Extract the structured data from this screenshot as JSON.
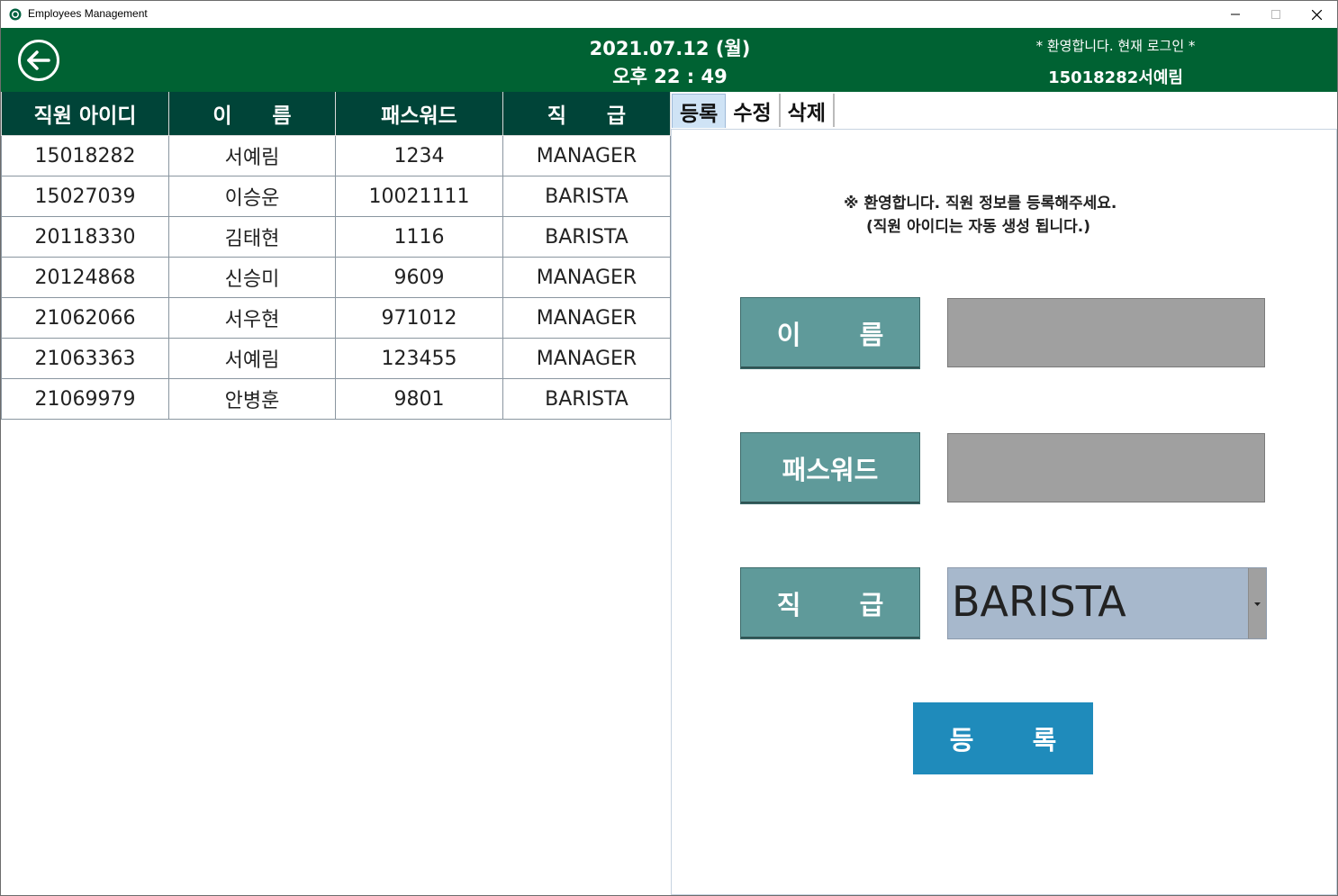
{
  "window": {
    "title": "Employees Management",
    "icons": {
      "app": "starbucks-logo-icon",
      "min": "minimize-icon",
      "max": "maximize-icon",
      "close": "close-icon"
    }
  },
  "header": {
    "back_icon": "arrow-left-circle-icon",
    "date": "2021.07.12 (월)",
    "time": "오후 22 : 49",
    "welcome": "* 환영합니다. 현재 로그인 *",
    "user": "15018282서예림",
    "bg_color": "#006233"
  },
  "table": {
    "columns": [
      "직원 아이디",
      "이 름",
      "패스워드",
      "직 급"
    ],
    "rows": [
      [
        "15018282",
        "서예림",
        "1234",
        "MANAGER"
      ],
      [
        "15027039",
        "이승운",
        "10021111",
        "BARISTA"
      ],
      [
        "20118330",
        "김태현",
        "1116",
        "BARISTA"
      ],
      [
        "20124868",
        "신승미",
        "9609",
        "MANAGER"
      ],
      [
        "21062066",
        "서우현",
        "971012",
        "MANAGER"
      ],
      [
        "21063363",
        "서예림",
        "123455",
        "MANAGER"
      ],
      [
        "21069979",
        "안병훈",
        "9801",
        "BARISTA"
      ]
    ]
  },
  "tabs": [
    "등록",
    "수정",
    "삭제"
  ],
  "form": {
    "notice_line1": "※ 환영합니다. 직원 정보를 등록해주세요.",
    "notice_line2": "(직원 아이디는 자동 생성 됩니다.)",
    "name_label": "이 름",
    "name_value": "",
    "password_label": "패스워드",
    "password_value": "",
    "grade_label": "직 급",
    "grade_selected": "BARISTA",
    "submit_label": "등 록"
  }
}
